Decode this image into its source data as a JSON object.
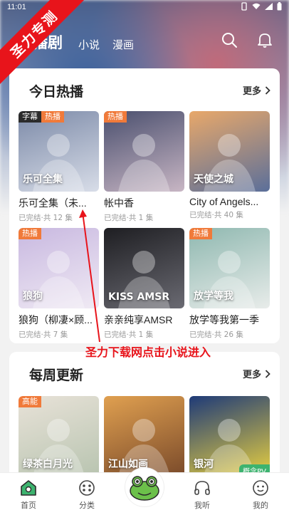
{
  "status": {
    "time": "11:01"
  },
  "ribbon": {
    "text": "圣力专测"
  },
  "nav": {
    "tabs": [
      {
        "label": "播剧",
        "active": true
      },
      {
        "label": "小说",
        "active": false
      },
      {
        "label": "漫画",
        "active": false
      }
    ]
  },
  "section1": {
    "title": "今日热播",
    "more": "更多",
    "items": [
      {
        "title": "乐可全集（未...",
        "meta": "已完结·共 12 集",
        "badges": [
          "字幕",
          "热播"
        ],
        "cover_text": "乐可全集",
        "cover": [
          "#7c8aa8",
          "#d8dde8"
        ]
      },
      {
        "title": "帐中香",
        "meta": "已完结·共 1 集",
        "badges": [
          "热播"
        ],
        "cover_text": "",
        "cover": [
          "#4a4f6e",
          "#c8b6c4"
        ]
      },
      {
        "title": "City of Angels...",
        "meta": "已完结·共 40 集",
        "badges": [],
        "cover_text": "天使之城",
        "cover": [
          "#e8a86a",
          "#5b6f9a"
        ]
      },
      {
        "title": "狼狗（柳凄×顾...",
        "meta": "已完结·共 7 集",
        "badges": [
          "热播"
        ],
        "cover_text": "狼狗",
        "cover": [
          "#c8b8e0",
          "#f0eaf4"
        ]
      },
      {
        "title": "亲亲纯享AMSR",
        "meta": "已完结·共 1 集",
        "badges": [],
        "cover_text": "KISS AMSR",
        "cover": [
          "#1e1e22",
          "#6a6a72"
        ]
      },
      {
        "title": "放学等我第一季",
        "meta": "已完结·共 26 集",
        "badges": [
          "热播"
        ],
        "cover_text": "放学等我",
        "cover": [
          "#8fb8b0",
          "#e8ecea"
        ]
      }
    ]
  },
  "section2": {
    "title": "每周更新",
    "more": "更多",
    "items": [
      {
        "badges": [
          "高能"
        ],
        "cover_text": "绿茶白月光",
        "cover": [
          "#e8e2d8",
          "#b8c4b0"
        ]
      },
      {
        "badges": [],
        "cover_text": "江山如画",
        "cover": [
          "#e0a050",
          "#7a4a2a"
        ]
      },
      {
        "badges": [],
        "cover_text": "银河",
        "cover": [
          "#1e3a78",
          "#e8d040"
        ],
        "corner_badge": "概念PV"
      }
    ]
  },
  "annotation": {
    "text": "圣力下载网点击小说进入"
  },
  "bottom_nav": {
    "items": [
      {
        "label": "首页"
      },
      {
        "label": "分类"
      },
      {
        "label": "我听"
      },
      {
        "label": "我的"
      }
    ]
  },
  "colors": {
    "accent": "#3db36f",
    "hot": "#f07a3a",
    "red": "#e8141b"
  }
}
